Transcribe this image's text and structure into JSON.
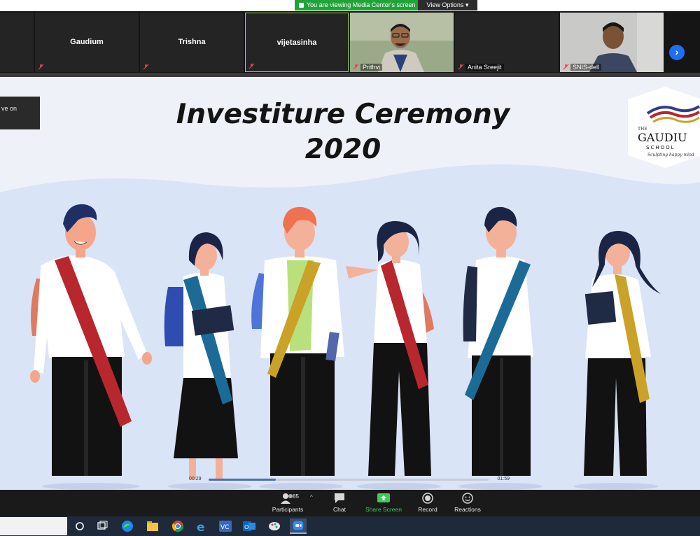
{
  "banner": {
    "viewing_text": "You are viewing Media Center's screen",
    "view_options": "View Options"
  },
  "participants": [
    {
      "name": "Gaudium",
      "label": "",
      "video": false
    },
    {
      "name": "Trishna",
      "label": "",
      "video": false
    },
    {
      "name": "vijetasinha",
      "label": "",
      "video": false,
      "active_speaker": true
    },
    {
      "name": "",
      "label": "Prithvi",
      "video": true
    },
    {
      "name": "",
      "label": "Anita Sreejit",
      "video": false
    },
    {
      "name": "",
      "label": "SNIS-dell",
      "video": true
    }
  ],
  "slide": {
    "title": "Investiture Ceremony",
    "year": "2020",
    "tooltip_fragment": "ve on",
    "logo": {
      "the": "THE",
      "name": "GAUDIU",
      "school": "SCHOOL",
      "tagline": "Sculpting happy mind"
    },
    "video": {
      "elapsed": "00:29",
      "duration": "01:59",
      "progress": 0.24
    }
  },
  "controls": {
    "participants_label": "Participants",
    "participants_count": "85",
    "chat_label": "Chat",
    "share_label": "Share Screen",
    "record_label": "Record",
    "reactions_label": "Reactions"
  },
  "taskbar": {
    "apps": [
      "start-circle-icon",
      "task-view-icon",
      "edge-icon",
      "file-explorer-icon",
      "chrome-icon",
      "internet-explorer-icon",
      "vc-app-icon",
      "outlook-icon",
      "paint-icon",
      "zoom-icon"
    ]
  },
  "colors": {
    "accent_green": "#22a33a",
    "share_green": "#3fca5b",
    "next_blue": "#1f6ff0",
    "slide_bg": "#eef1f7",
    "sash_red": "#b8272d",
    "sash_blue": "#1c6b97",
    "sash_gold": "#c9a227"
  }
}
